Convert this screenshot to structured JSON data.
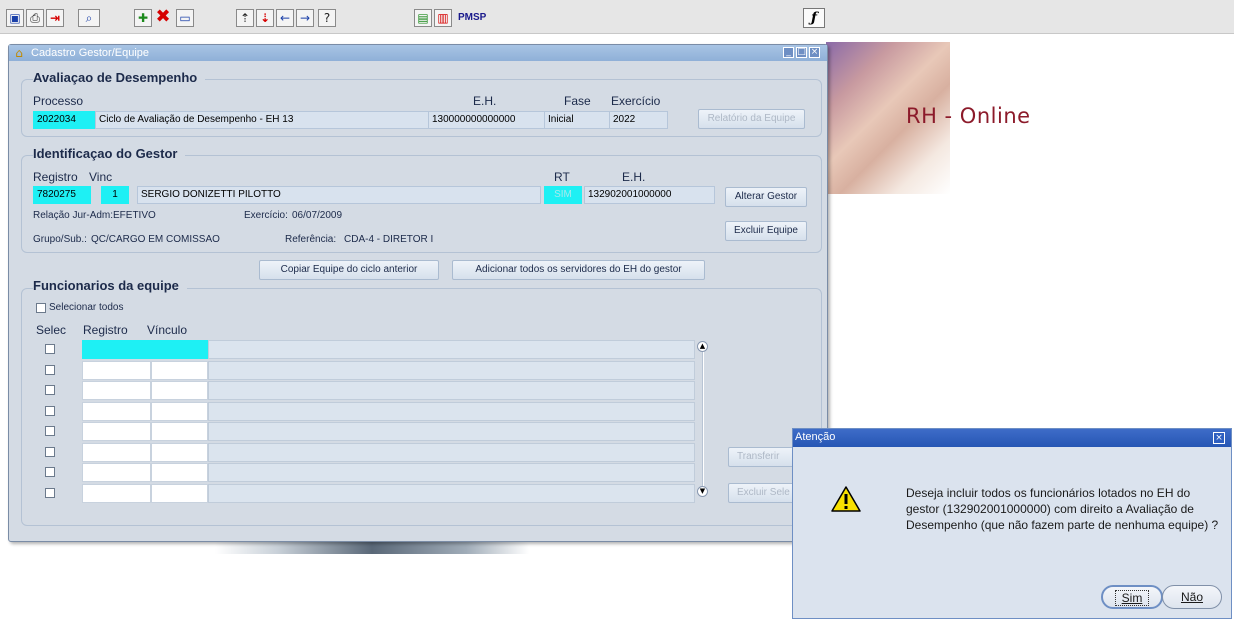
{
  "toolbar": {
    "icons": [
      "save-icon",
      "print-icon",
      "exit-icon",
      "query-icon",
      "new-record-icon",
      "delete-icon",
      "clear-icon",
      "first-icon",
      "last-icon",
      "prev-icon",
      "next-icon",
      "help-icon",
      "menu-icon",
      "window-icon"
    ],
    "org_label": "PMSP"
  },
  "banner": {
    "title": "RH - Online"
  },
  "main_window": {
    "title": "Cadastro Gestor/Equipe",
    "avaliacao": {
      "title": "Avaliaçao de Desempenho",
      "processo_label": "Processo",
      "eh_label": "E.H.",
      "fase_label": "Fase",
      "exercicio_label": "Exercício",
      "processo_value": "2022034",
      "ciclo_value": "Ciclo de Avaliação de Desempenho - EH 13",
      "eh_value": "130000000000000",
      "fase_value": "Inicial",
      "exercicio_value": "2022",
      "relatorio_button": "Relatório da Equipe"
    },
    "gestor": {
      "title": "Identificaçao do Gestor",
      "registro_label": "Registro",
      "vinc_label": "Vinc",
      "rt_label": "RT",
      "eh_label": "E.H.",
      "registro_value": "7820275",
      "vinc_value": "1",
      "nome_value": "SERGIO DONIZETTI PILOTTO",
      "rt_value": "SIM",
      "eh_value": "132902001000000",
      "relacao_label": "Relação Jur-Adm:",
      "relacao_value": "EFETIVO",
      "exercicio_label": "Exercício:",
      "exercicio_value": "06/07/2009",
      "grupo_label": "Grupo/Sub.:",
      "grupo_value": "QC/CARGO EM COMISSAO",
      "referencia_label": "Referência:",
      "referencia_value": "CDA-4 - DIRETOR I",
      "alterar_button": "Alterar Gestor",
      "excluir_button": "Excluir Equipe"
    },
    "copiar_button": "Copiar Equipe do ciclo anterior",
    "adicionar_button": "Adicionar todos os servidores do EH do gestor",
    "funcionarios": {
      "title": "Funcionarios da equipe",
      "selecionar_todos": "Selecionar todos",
      "col_selec": "Selec",
      "col_registro": "Registro",
      "col_vinculo": "Vínculo",
      "transferir_button": "Transferir",
      "excluir_button": "Excluir Sele"
    }
  },
  "dialog": {
    "title": "Atenção",
    "message": "Deseja incluir todos os funcionários lotados no EH do gestor (132902001000000) com direito a Avaliação de Desempenho (que não fazem parte de nenhuma equipe) ?",
    "sim_button": "Sim",
    "nao_button": "Não"
  }
}
